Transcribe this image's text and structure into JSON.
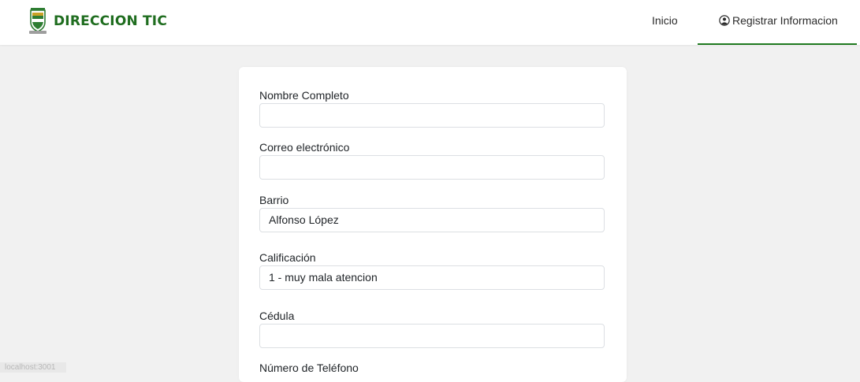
{
  "header": {
    "brand_text": "DIRECCION TIC",
    "nav_inicio": "Inicio",
    "nav_registrar": "Registrar Informacion"
  },
  "form": {
    "nombre_label": "Nombre Completo",
    "nombre_value": "",
    "correo_label": "Correo electrónico",
    "correo_value": "",
    "barrio_label": "Barrio",
    "barrio_value": "Alfonso López",
    "calificacion_label": "Calificación",
    "calificacion_value": "1 - muy mala atencion",
    "cedula_label": "Cédula",
    "cedula_value": "",
    "telefono_label": "Número de Teléfono"
  },
  "watermark": "localhost:3001",
  "colors": {
    "brand_green": "#1f6d1f",
    "active_underline": "#1f7a1f",
    "background": "#f1f1f1"
  },
  "icons": {
    "logo": "crest-shield-icon",
    "registrar": "user-circle-icon"
  }
}
